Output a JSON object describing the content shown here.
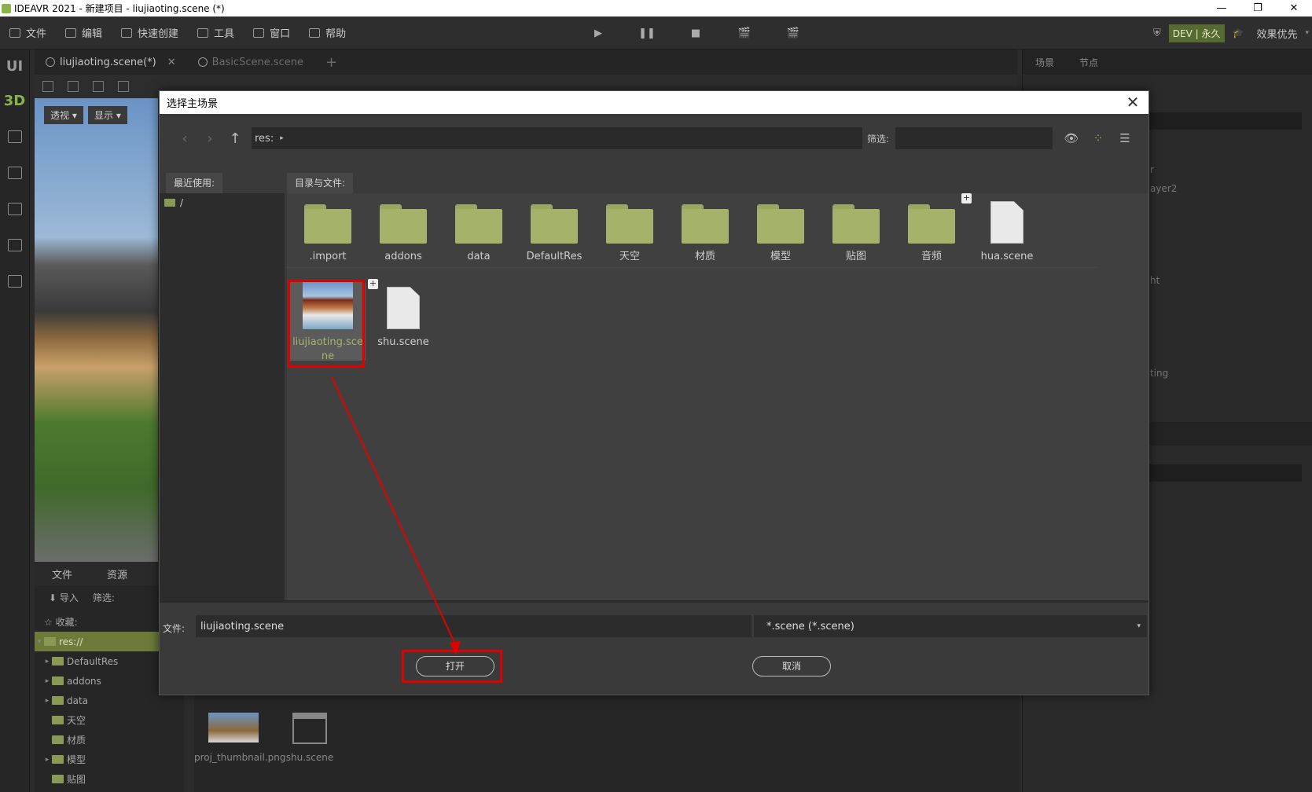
{
  "window": {
    "title": "IDEAVR 2021 - 新建项目 - liujiaoting.scene (*)",
    "minimize": "—",
    "maximize": "❐",
    "close": "✕"
  },
  "menubar": {
    "items": [
      "文件",
      "编辑",
      "快速创建",
      "工具",
      "窗口",
      "帮助"
    ],
    "play": "▶",
    "pause": "❚❚",
    "stop": "■",
    "cam1": "🎬",
    "cam2": "🎬",
    "license": "DEV | 永久",
    "quality": "效果优先"
  },
  "leftbar": {
    "ui": "UI",
    "d3": "3D"
  },
  "editor": {
    "tabs": [
      {
        "label": "liujiaoting.scene(*)"
      },
      {
        "label": "BasicScene.scene"
      }
    ],
    "add_tab": "+",
    "viewport_btn1": "透视 ▾",
    "viewport_btn2": "显示 ▾"
  },
  "filepanel": {
    "tab_files": "文件",
    "tab_assets": "资源",
    "import": "⬇ 导入",
    "filter": "筛选:",
    "favorites": "☆ 收藏:",
    "tree": [
      {
        "label": "res://",
        "arrow": "▾"
      },
      {
        "label": "DefaultRes",
        "arrow": "▸"
      },
      {
        "label": "addons",
        "arrow": "▸"
      },
      {
        "label": "data",
        "arrow": "▸"
      },
      {
        "label": "天空",
        "arrow": ""
      },
      {
        "label": "材质",
        "arrow": ""
      },
      {
        "label": "模型",
        "arrow": "▸"
      },
      {
        "label": "贴图",
        "arrow": ""
      }
    ],
    "bottom_items": [
      "proj_thumbnail.png",
      "shu.scene"
    ]
  },
  "rightpanel": {
    "tab_scene": "场景",
    "tab_node": "节点",
    "ghost1": "r",
    "ghost2": "ayer2",
    "ghost3": "ht",
    "ghost4": "ting"
  },
  "dialog": {
    "title": "选择主场景",
    "close": "✕",
    "back": "‹",
    "forward": "›",
    "up": "↑",
    "path": "res:",
    "path_caret": "▸",
    "filter_label": "筛选:",
    "filter_value": "",
    "recent_label": "最近使用:",
    "recent_items": [
      "/"
    ],
    "files_label": "目录与文件:",
    "row1": [
      {
        "name": ".import",
        "kind": "folder"
      },
      {
        "name": "addons",
        "kind": "folder"
      },
      {
        "name": "data",
        "kind": "folder"
      },
      {
        "name": "DefaultRes",
        "kind": "folder"
      },
      {
        "name": "天空",
        "kind": "folder"
      },
      {
        "name": "材质",
        "kind": "folder"
      },
      {
        "name": "模型",
        "kind": "folder"
      },
      {
        "name": "贴图",
        "kind": "folder"
      },
      {
        "name": "音频",
        "kind": "folder"
      },
      {
        "name": "hua.scene",
        "kind": "file"
      }
    ],
    "row2": [
      {
        "name": "liujiaoting.scene",
        "kind": "scene-thumb",
        "selected": true
      },
      {
        "name": "shu.scene",
        "kind": "file"
      }
    ],
    "filename_label": "文件:",
    "filename_value": "liujiaoting.scene",
    "filetype": "*.scene (*.scene)",
    "filetype_caret": "▾",
    "open_button": "打开",
    "cancel_button": "取消"
  },
  "colors": {
    "accent": "#8ab34a",
    "annotation": "#e00000",
    "folder": "#a5b36a"
  }
}
